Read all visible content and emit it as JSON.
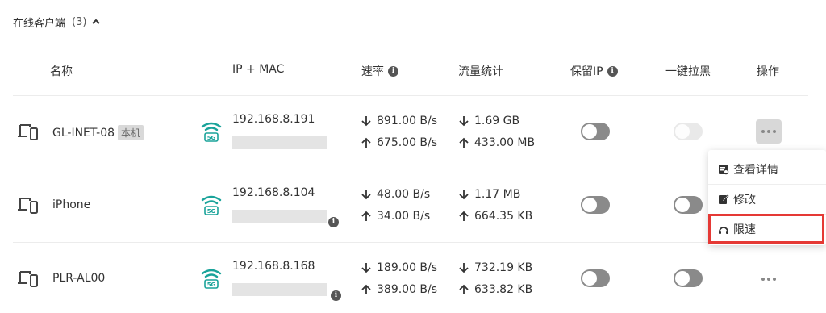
{
  "section": {
    "title": "在线客户端",
    "count": "(3)"
  },
  "columns": {
    "name": "名称",
    "ip_mac": "IP + MAC",
    "rate": "速率",
    "traffic": "流量统计",
    "reserve_ip": "保留IP",
    "block": "一键拉黑",
    "actions": "操作"
  },
  "clients": [
    {
      "name": "GL-INET-08",
      "tag": "本机",
      "ip": "192.168.8.191",
      "band": "5G",
      "down_rate": "891.00 B/s",
      "up_rate": "675.00 B/s",
      "down_traffic": "1.69 GB",
      "up_traffic": "433.00 MB",
      "reserve_ip": false,
      "block_disabled": true
    },
    {
      "name": "iPhone",
      "ip": "192.168.8.104",
      "band": "5G",
      "down_rate": "48.00 B/s",
      "up_rate": "34.00 B/s",
      "down_traffic": "1.17 MB",
      "up_traffic": "664.35 KB",
      "reserve_ip": false,
      "block_disabled": false
    },
    {
      "name": "PLR-AL00",
      "ip": "192.168.8.168",
      "band": "5G",
      "down_rate": "189.00 B/s",
      "up_rate": "389.00 B/s",
      "down_traffic": "732.19 KB",
      "up_traffic": "633.82 KB",
      "reserve_ip": false,
      "block_disabled": false
    }
  ],
  "menu": {
    "view_details": "查看详情",
    "edit": "修改",
    "limit_speed": "限速"
  },
  "icons": {
    "device": "device-icon",
    "wifi": "wifi-5g-icon",
    "more": "more-icon",
    "details": "details-icon",
    "edit": "edit-icon",
    "speed": "speed-limit-icon"
  },
  "colors": {
    "wifi": "#1aa39a",
    "highlight": "#e53935",
    "toggle_off": "#8a8a8a"
  }
}
